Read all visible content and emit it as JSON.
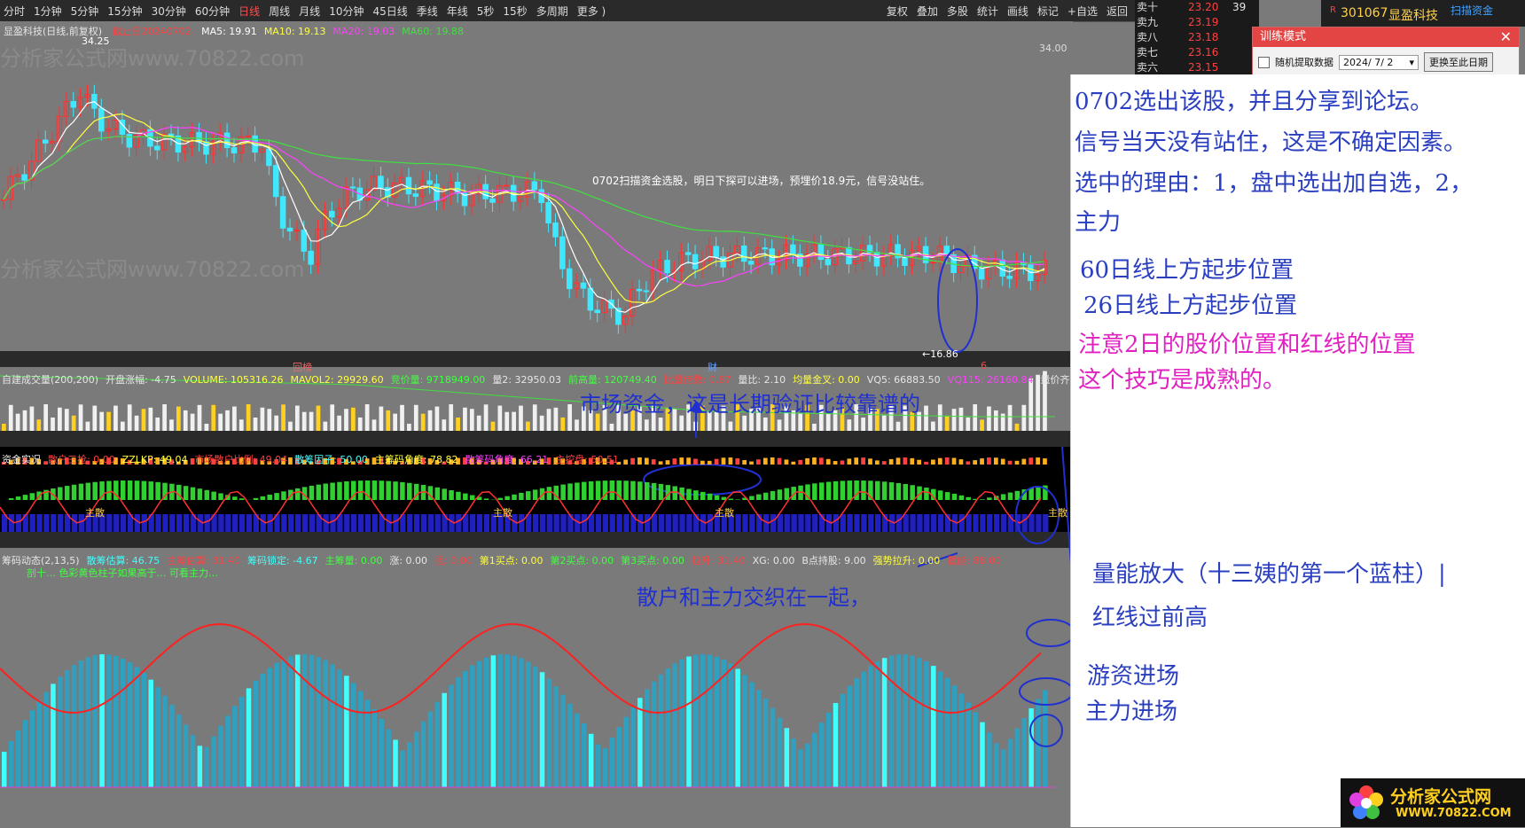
{
  "topbar": {
    "periods": [
      "分时",
      "1分钟",
      "5分钟",
      "15分钟",
      "30分钟",
      "60分钟",
      "日线",
      "周线",
      "月线",
      "10分钟",
      "45日线",
      "季线",
      "年线",
      "5秒",
      "15秒",
      "多周期",
      "更多 )"
    ],
    "active_period": "日线",
    "tools": [
      "复权",
      "叠加",
      "多股",
      "统计",
      "画线",
      "标记",
      "+自选",
      "返回"
    ]
  },
  "main_chart": {
    "title": "显盈科技(日线,前复权)",
    "date_label": "截止日20240702",
    "ma": [
      {
        "label": "MA5: 19.91",
        "color": "#ffffff"
      },
      {
        "label": "MA10: 19.13",
        "color": "#ffff40"
      },
      {
        "label": "MA20: 19.03",
        "color": "#ff40ff"
      },
      {
        "label": "MA60: 19.88",
        "color": "#40e040"
      }
    ],
    "price_top": "34.00",
    "high_label": "34.25",
    "low_label": "←16.86",
    "annotation": "0702扫描资金选股，明日下探可以进场，预埋价18.9元，信号没站住。",
    "watermark": "分析家公式网www.70822.com",
    "marker_left": "回榜",
    "marker_mid": "财",
    "marker_right": "6"
  },
  "vol_panel": {
    "items": [
      {
        "t": "自建成交量(200,200)",
        "c": "#e6e6e6"
      },
      {
        "t": "开盘涨幅: -4.75",
        "c": "#e6e6e6"
      },
      {
        "t": "VOLUME: 105316.26",
        "c": "#ffff40"
      },
      {
        "t": "MAVOL2: 29929.60",
        "c": "#ffff40"
      },
      {
        "t": "竞价量: 9718949.00",
        "c": "#40ff40"
      },
      {
        "t": "量2: 32950.03",
        "c": "#e6e6e6"
      },
      {
        "t": "前高量: 120749.40",
        "c": "#40ff40"
      },
      {
        "t": "比量倍数: 0.87",
        "c": "#ff4040"
      },
      {
        "t": "量比: 2.10",
        "c": "#e6e6e6"
      },
      {
        "t": "均量金叉: 0.00",
        "c": "#ffff40"
      },
      {
        "t": "VQ5: 66883.50",
        "c": "#e6e6e6"
      },
      {
        "t": "VQ115: 26160.84",
        "c": "#ff40ff"
      },
      {
        "t": "量价齐升",
        "c": "#e6e6e6"
      }
    ],
    "annotation": "市场资金，这是长期验证比较靠谱的"
  },
  "fund_panel": {
    "items": [
      {
        "t": "资金实况",
        "c": "#e6e6e6"
      },
      {
        "t": "散户三抢: 0.00",
        "c": "#ff4040"
      },
      {
        "t": "ZZLKP: 49.04",
        "c": "#ffff40"
      },
      {
        "t": "市场散户比例: 49.04",
        "c": "#ff4040"
      },
      {
        "t": "散筹因子: 50.00",
        "c": "#40ffff"
      },
      {
        "t": "主筹码角度: 78.82",
        "c": "#ffff40"
      },
      {
        "t": "散筹码角度: 66.21",
        "c": "#ff40ff"
      },
      {
        "t": "主控盘: 50.51",
        "c": "#ff4040"
      }
    ],
    "labels": [
      "主散",
      "主散",
      "主散",
      "主散"
    ]
  },
  "chip_panel": {
    "items": [
      {
        "t": "筹码动态(2,13,5)",
        "c": "#e6e6e6"
      },
      {
        "t": "散筹估算: 46.75",
        "c": "#40ffff"
      },
      {
        "t": "主筹估算: 31.40",
        "c": "#ff4040"
      },
      {
        "t": "筹码锁定: -4.67",
        "c": "#40ffff"
      },
      {
        "t": "主筹量: 0.00",
        "c": "#40ff40"
      },
      {
        "t": "涨: 0.00",
        "c": "#e6e6e6"
      },
      {
        "t": "强: 0.00",
        "c": "#ff4040"
      },
      {
        "t": "第1买点: 0.00",
        "c": "#ffff40"
      },
      {
        "t": "第2买点: 0.00",
        "c": "#40ff40"
      },
      {
        "t": "第3买点: 0.00",
        "c": "#40ff40"
      },
      {
        "t": "拉升: 31.40",
        "c": "#ff4040"
      },
      {
        "t": "XG: 0.00",
        "c": "#e6e6e6"
      },
      {
        "t": "B点持股: 9.00",
        "c": "#e6e6e6"
      },
      {
        "t": "强势拉升: 0.00",
        "c": "#ffff40"
      },
      {
        "t": "量能: 88.00",
        "c": "#ff4040"
      }
    ],
    "subtext": "剖十…  色彩黄色柱子如果高于…  可看主力…",
    "annotation": "散户和主力交织在一起，"
  },
  "order_book": [
    {
      "label": "卖十",
      "price": "23.20",
      "vol": "39"
    },
    {
      "label": "卖九",
      "price": "23.19",
      "vol": ""
    },
    {
      "label": "卖八",
      "price": "23.18",
      "vol": ""
    },
    {
      "label": "卖七",
      "price": "23.16",
      "vol": ""
    },
    {
      "label": "卖六",
      "price": "23.15",
      "vol": ""
    }
  ],
  "stock_tag": {
    "code": "301067",
    "name": "显盈科技",
    "extra": "扫描资金"
  },
  "dialog": {
    "title": "训练模式",
    "checkbox_label": "随机提取数据",
    "date": "2024/ 7/ 2",
    "button": "更换至此日期"
  },
  "notes": [
    {
      "text": "0702选出该股，并且分享到论坛。",
      "color": "#2a3fc0"
    },
    {
      "text": "信号当天没有站住，这是不确定因素。",
      "color": "#2a3fc0"
    },
    {
      "text": "选中的理由：1，盘中选出加自选，2，",
      "color": "#2a3fc0"
    },
    {
      "text": "主力",
      "color": "#2a3fc0"
    },
    {
      "text": "60日线上方起步位置",
      "color": "#2a3fc0"
    },
    {
      "text": "26日线上方起步位置",
      "color": "#2a3fc0"
    },
    {
      "text": "注意2日的股价位置和红线的位置",
      "color": "#e020c0"
    },
    {
      "text": "这个技巧是成熟的。",
      "color": "#e020c0"
    },
    {
      "text": "量能放大（十三姨的第一个蓝柱）|",
      "color": "#2a3fc0"
    },
    {
      "text": "红线过前高",
      "color": "#2a3fc0"
    },
    {
      "text": "游资进场",
      "color": "#2a3fc0"
    },
    {
      "text": "主力进场",
      "color": "#2a3fc0"
    }
  ],
  "brand": {
    "name": "分析家公式网",
    "url": "WWW.70822.COM"
  }
}
